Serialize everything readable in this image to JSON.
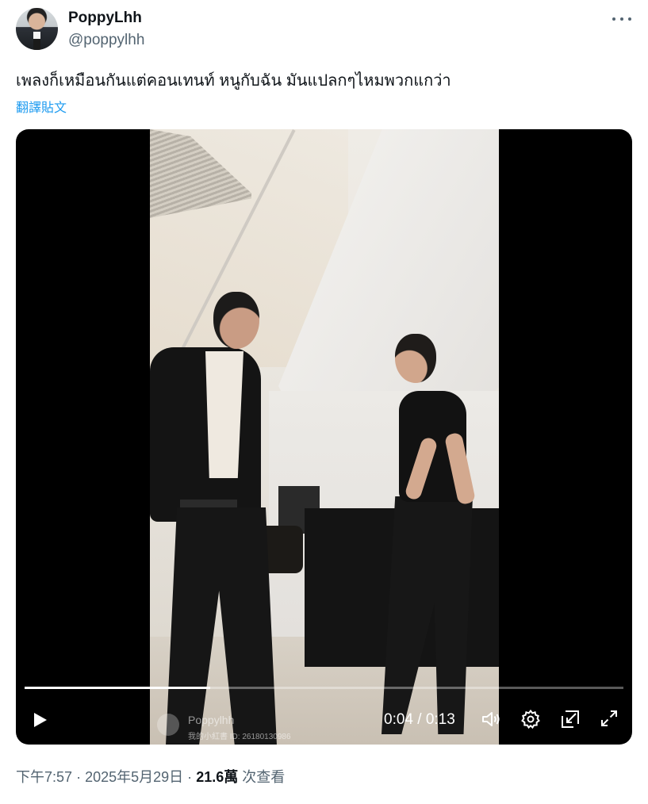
{
  "post": {
    "author_name": "PoppyLhh",
    "author_handle": "@poppylhh",
    "text": "เพลงก็เหมือนกันแต่คอนเทนท์ หนูกับฉัน มันแปลกๆไหมพวกแกว่า",
    "translate_label": "翻譯貼文"
  },
  "video": {
    "current_time": "0:04",
    "separator": "/",
    "duration": "0:13",
    "progress_fraction": 0.31,
    "watermark_name": "Poppylhh",
    "watermark_id": "我的小紅書 ID: 26180130986"
  },
  "meta": {
    "time": "下午7:57",
    "dot1": "·",
    "date": "2025年5月29日",
    "dot2": "·",
    "views": "21.6萬",
    "views_label": "次查看"
  },
  "icons": {
    "more": "more-horizontal-icon",
    "play": "play-icon",
    "volume": "volume-icon",
    "settings": "gear-icon",
    "pip": "picture-in-picture-icon",
    "fullscreen": "fullscreen-icon"
  },
  "colors": {
    "accent": "#1d9bf0",
    "text_primary": "#0f1419",
    "text_secondary": "#536471"
  }
}
